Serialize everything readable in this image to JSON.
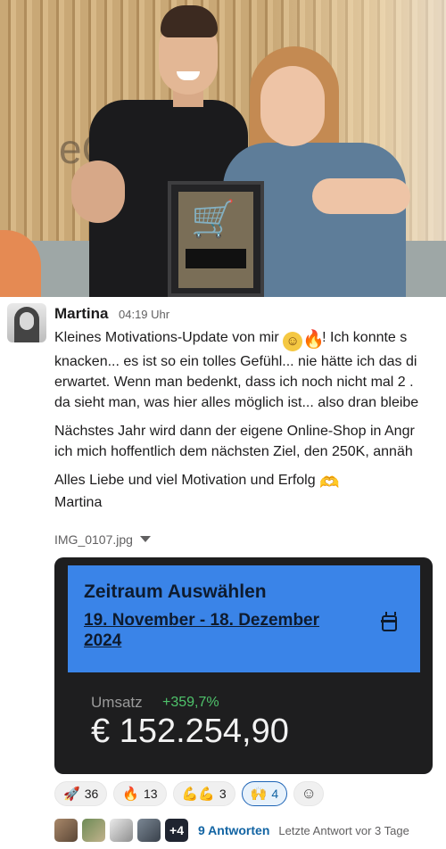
{
  "photo": {
    "logo_text": "eC"
  },
  "message": {
    "author": "Martina",
    "time": "04:19 Uhr",
    "para1": {
      "l1_a": "Kleines Motivations-Update von mir ",
      "l1_b": "! Ich konnte s",
      "l2": "knacken... es ist so ein tolles Gefühl... nie hätte ich das di",
      "l3": "erwartet. Wenn man bedenkt, dass ich noch nicht mal 2 .",
      "l4": "da sieht man, was hier alles möglich ist... also dran bleibe"
    },
    "para2": {
      "l1": "Nächstes Jahr wird dann der eigene Online-Shop in Angr",
      "l2": "ich mich hoffentlich dem nächsten Ziel, den 250K, annäh"
    },
    "para3": {
      "l1": "Alles Liebe und viel Motivation und Erfolg ",
      "l2": "Martina"
    },
    "icons": {
      "smile": "smiling-face-emoji",
      "fire": "fire-emoji",
      "heart_hands": "heart-hands-emoji"
    }
  },
  "attachment": {
    "filename": "IMG_0107.jpg"
  },
  "screenshot": {
    "title": "Zeitraum Auswählen",
    "range": "19. November - 18. Dezember 2024",
    "label": "Umsatz",
    "change": "+359,7%",
    "value": "€ 152.254,90",
    "colors": {
      "header": "#3a84e8",
      "background": "#1e1e1f",
      "positive": "#4fc36b"
    }
  },
  "reactions": [
    {
      "icon": "rocket",
      "glyph": "🚀",
      "count": "36"
    },
    {
      "icon": "fire",
      "glyph": "🔥",
      "count": "13"
    },
    {
      "icon": "muscle",
      "glyph": "💪💪",
      "count": "3"
    },
    {
      "icon": "raised-hands",
      "glyph": "🙌",
      "count": "4",
      "active": true
    }
  ],
  "thread": {
    "more": "+4",
    "replies": "9 Antworten",
    "last_reply": "Letzte Antwort vor 3 Tage"
  }
}
